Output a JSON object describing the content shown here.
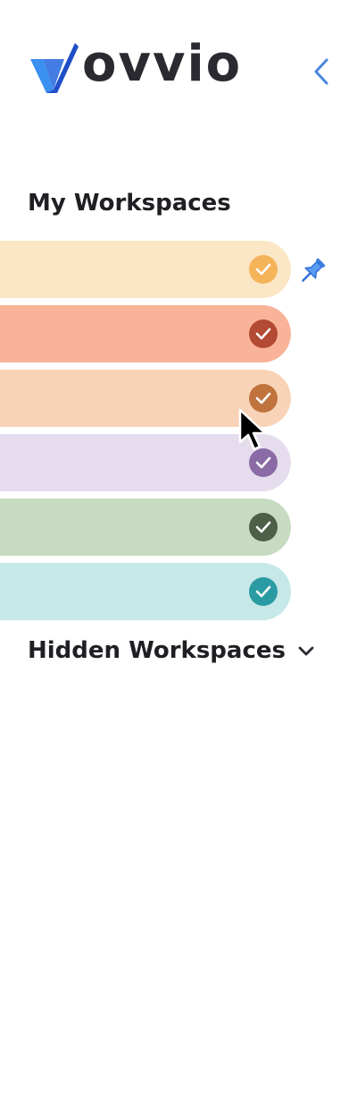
{
  "brand": {
    "name": "ovvio",
    "logo_icon": "check-swoosh-logo",
    "colors": {
      "logo_dark": "#1f4fc8",
      "logo_light": "#3a8ff0",
      "text": "#2a2a30"
    }
  },
  "header": {
    "collapse_icon": "chevron-left-icon",
    "collapse_color": "#4a86e0"
  },
  "my_workspaces": {
    "title": "My Workspaces",
    "pin_icon": "pushpin-icon",
    "items": [
      {
        "bg": "#fbe7c6",
        "check_bg": "#f5b35a",
        "checked": true
      },
      {
        "bg": "#f9b398",
        "check_bg": "#b34a33",
        "checked": true
      },
      {
        "bg": "#f9d3b7",
        "check_bg": "#c0733d",
        "checked": true
      },
      {
        "bg": "#e5dded",
        "check_bg": "#8b6ba6",
        "checked": true
      },
      {
        "bg": "#c6dbc0",
        "check_bg": "#4c5f47",
        "checked": true
      },
      {
        "bg": "#c6e8e8",
        "check_bg": "#2a9ba2",
        "checked": true
      }
    ]
  },
  "hidden_workspaces": {
    "title": "Hidden Workspaces",
    "toggle_icon": "chevron-down-icon"
  }
}
